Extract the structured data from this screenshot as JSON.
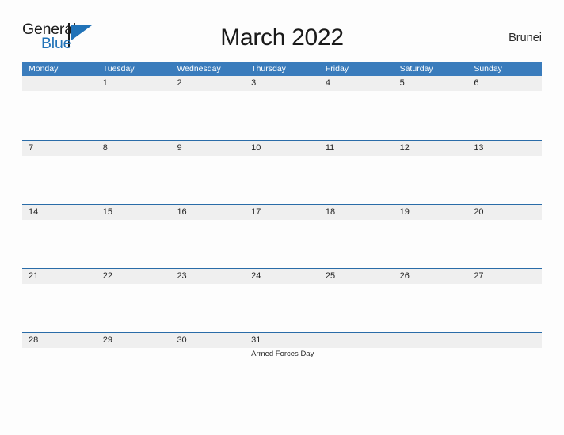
{
  "brand": {
    "name_part1": "General",
    "name_part2": "Blue",
    "mark": "triangle-flag-icon",
    "color_dark": "#1c1c1c",
    "color_blue": "#2173b8"
  },
  "header": {
    "title": "March 2022",
    "country": "Brunei"
  },
  "colors": {
    "header_blue": "#3a7cbc",
    "row_divider_blue": "#2a6ca8",
    "date_band_gray": "#efefef",
    "page_background": "#fdfdfd",
    "text": "#262626"
  },
  "calendar": {
    "month": "March",
    "year": "2022",
    "weekday_headers": [
      "Monday",
      "Tuesday",
      "Wednesday",
      "Thursday",
      "Friday",
      "Saturday",
      "Sunday"
    ],
    "weeks": [
      [
        {
          "num": "",
          "events": []
        },
        {
          "num": "1",
          "events": []
        },
        {
          "num": "2",
          "events": []
        },
        {
          "num": "3",
          "events": []
        },
        {
          "num": "4",
          "events": []
        },
        {
          "num": "5",
          "events": []
        },
        {
          "num": "6",
          "events": []
        }
      ],
      [
        {
          "num": "7",
          "events": []
        },
        {
          "num": "8",
          "events": []
        },
        {
          "num": "9",
          "events": []
        },
        {
          "num": "10",
          "events": []
        },
        {
          "num": "11",
          "events": []
        },
        {
          "num": "12",
          "events": []
        },
        {
          "num": "13",
          "events": []
        }
      ],
      [
        {
          "num": "14",
          "events": []
        },
        {
          "num": "15",
          "events": []
        },
        {
          "num": "16",
          "events": []
        },
        {
          "num": "17",
          "events": []
        },
        {
          "num": "18",
          "events": []
        },
        {
          "num": "19",
          "events": []
        },
        {
          "num": "20",
          "events": []
        }
      ],
      [
        {
          "num": "21",
          "events": []
        },
        {
          "num": "22",
          "events": []
        },
        {
          "num": "23",
          "events": []
        },
        {
          "num": "24",
          "events": []
        },
        {
          "num": "25",
          "events": []
        },
        {
          "num": "26",
          "events": []
        },
        {
          "num": "27",
          "events": []
        }
      ],
      [
        {
          "num": "28",
          "events": []
        },
        {
          "num": "29",
          "events": []
        },
        {
          "num": "30",
          "events": []
        },
        {
          "num": "31",
          "events": [
            "Armed Forces Day"
          ]
        },
        {
          "num": "",
          "events": []
        },
        {
          "num": "",
          "events": []
        },
        {
          "num": "",
          "events": []
        }
      ]
    ]
  }
}
